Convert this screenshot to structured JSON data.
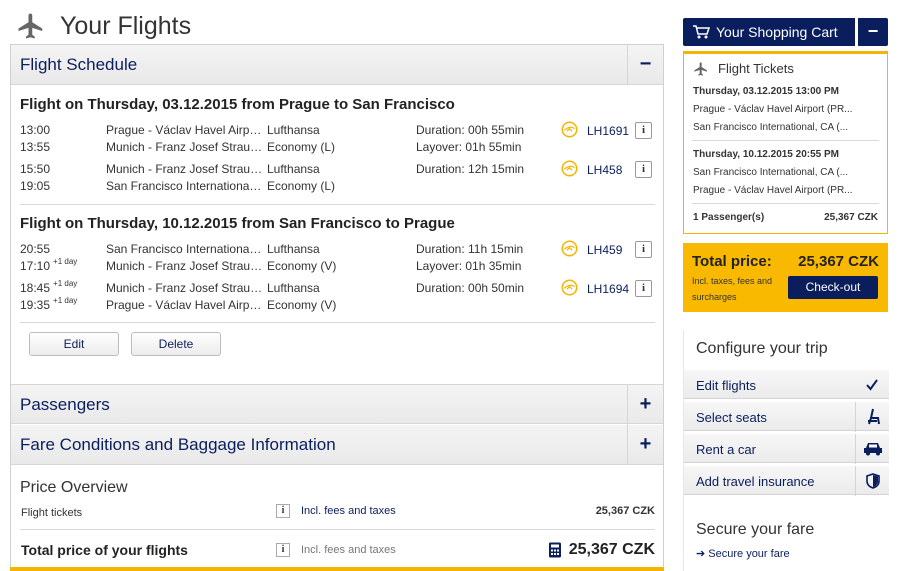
{
  "page": {
    "title": "Your Flights"
  },
  "schedule": {
    "header": "Flight Schedule",
    "collapse_symbol": "−",
    "outbound": {
      "title": "Flight on Thursday, 03.12.2015 from Prague to San Francisco",
      "segments": [
        {
          "dep_time": "13:00",
          "arr_time": "13:55",
          "dep_place": "Prague - Václav Havel Airport (PRG)",
          "arr_place": "Munich - Franz Josef Strauss (MUC)",
          "airline": "Lufthansa",
          "cabin": "Economy (L)",
          "duration": "Duration: 00h 55min",
          "layover": "Layover: 01h 55min",
          "flight_no": "LH1691"
        },
        {
          "dep_time": "15:50",
          "arr_time": "19:05",
          "dep_place": "Munich - Franz Josef Strauss (MUC)",
          "arr_place": "San Francisco International, CA (SFO)",
          "airline": "Lufthansa",
          "cabin": "Economy (L)",
          "duration": "Duration: 12h 15min",
          "flight_no": "LH458"
        }
      ]
    },
    "return": {
      "title": "Flight on Thursday, 10.12.2015 from San Francisco to Prague",
      "segments": [
        {
          "dep_time": "20:55",
          "arr_time": "17:10",
          "arr_day": "+1 day",
          "dep_place": "San Francisco International, CA (SFO)",
          "arr_place": "Munich - Franz Josef Strauss (MUC)",
          "airline": "Lufthansa",
          "cabin": "Economy (V)",
          "duration": "Duration: 11h 15min",
          "layover": "Layover: 01h 35min",
          "flight_no": "LH459"
        },
        {
          "dep_time": "18:45",
          "dep_day": "+1 day",
          "arr_time": "19:35",
          "arr_day": "+1 day",
          "dep_place": "Munich - Franz Josef Strauss (MUC)",
          "arr_place": "Prague - Václav Havel Airport (PRG)",
          "airline": "Lufthansa",
          "cabin": "Economy (V)",
          "duration": "Duration: 00h 50min",
          "flight_no": "LH1694"
        }
      ]
    },
    "edit_label": "Edit",
    "delete_label": "Delete"
  },
  "passengers": {
    "header": "Passengers",
    "expand_symbol": "+"
  },
  "fare": {
    "header": "Fare Conditions and Baggage Information",
    "expand_symbol": "+"
  },
  "price_overview": {
    "title": "Price Overview",
    "tickets_label": "Flight tickets",
    "tickets_note": "Incl. fees and taxes",
    "tickets_amount": "25,367 CZK",
    "total_label": "Total price of your flights",
    "total_note": "Incl. fees and taxes",
    "total_amount": "25,367 CZK"
  },
  "cart": {
    "label": "Your Shopping Cart",
    "collapse_symbol": "−",
    "tickets_title": "Flight Tickets",
    "outbound_date": "Thursday, 03.12.2015 13:00 PM",
    "outbound_from": "Prague - Václav Havel Airport (PR...",
    "outbound_to": "San Francisco International, CA (...",
    "return_date": "Thursday, 10.12.2015 20:55 PM",
    "return_from": "San Francisco International, CA (...",
    "return_to": "Prague - Václav Havel Airport (PR...",
    "passengers": "1 Passenger(s)",
    "passengers_amount": "25,367 CZK"
  },
  "total": {
    "label": "Total price:",
    "amount": "25,367 CZK",
    "note_line1": "Incl. taxes, fees and",
    "note_line2": "surcharges",
    "checkout_label": "Check-out"
  },
  "configure": {
    "title": "Configure your trip",
    "items": [
      {
        "label": "Edit flights",
        "icon": "check-icon"
      },
      {
        "label": "Select seats",
        "icon": "seat-icon"
      },
      {
        "label": "Rent a car",
        "icon": "car-icon"
      },
      {
        "label": "Add travel insurance",
        "icon": "shield-icon"
      }
    ]
  },
  "secure": {
    "title": "Secure your fare",
    "link": "Secure your fare"
  },
  "colors": {
    "navy": "#0a1e5e",
    "yellow": "#f9b900"
  }
}
